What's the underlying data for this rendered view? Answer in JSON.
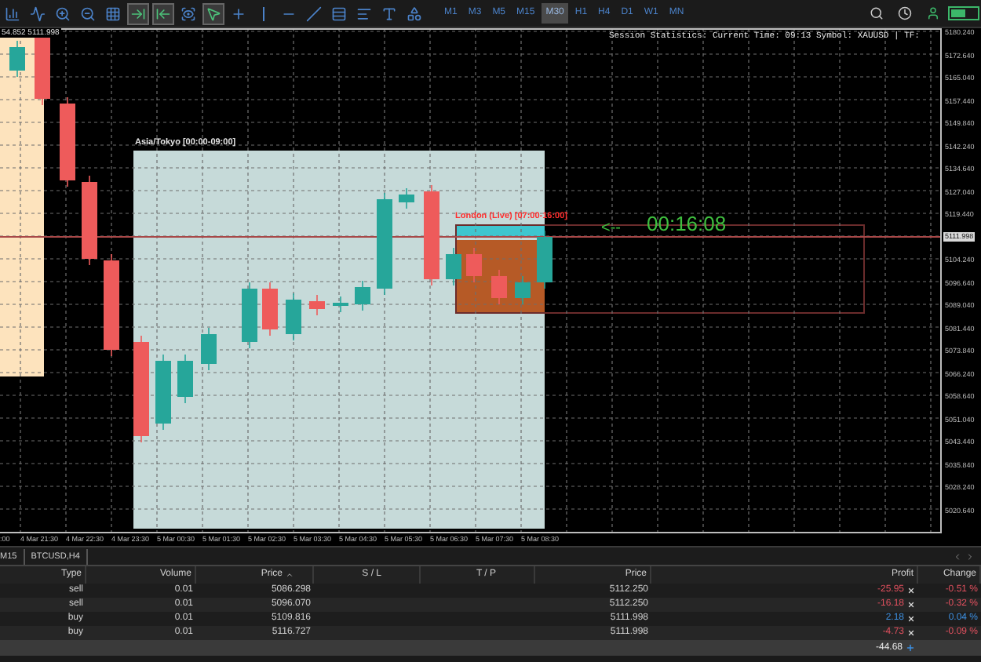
{
  "toolbar": {
    "tools": [
      {
        "kind": "indicator",
        "selected": false
      },
      {
        "kind": "chart-line",
        "selected": false
      },
      {
        "kind": "zoom-in",
        "selected": false
      },
      {
        "kind": "zoom-out",
        "selected": false
      },
      {
        "kind": "grid",
        "selected": false
      },
      {
        "kind": "autoscroll",
        "selected": true
      },
      {
        "kind": "shift",
        "selected": true
      },
      {
        "kind": "camera",
        "selected": false
      },
      {
        "kind": "cursor",
        "selected": true
      },
      {
        "kind": "crosshair",
        "selected": false
      },
      {
        "kind": "vline",
        "selected": false
      },
      {
        "kind": "hline",
        "selected": false
      },
      {
        "kind": "trend",
        "selected": false
      },
      {
        "kind": "channel",
        "selected": false
      },
      {
        "kind": "fibo",
        "selected": false
      },
      {
        "kind": "text",
        "selected": false
      },
      {
        "kind": "shapes",
        "selected": false
      }
    ],
    "timeframes": [
      {
        "label": "M1",
        "selected": false
      },
      {
        "label": "M3",
        "selected": false
      },
      {
        "label": "M5",
        "selected": false
      },
      {
        "label": "M15",
        "selected": false
      },
      {
        "label": "M30",
        "selected": true
      },
      {
        "label": "H1",
        "selected": false
      },
      {
        "label": "H4",
        "selected": false
      },
      {
        "label": "D1",
        "selected": false
      },
      {
        "label": "W1",
        "selected": false
      },
      {
        "label": "MN",
        "selected": false
      }
    ]
  },
  "chart": {
    "ohlc_header": "54.852 5111.998",
    "session_statistics": "Session Statistics: Current Time: 09:13 Symbol: XAUUSD | TF:",
    "asia_label": "Asia/Tokyo [00:00-09:00]",
    "london_label": "London (Live) [07:00-16:00]",
    "countdown_arrow": "<--",
    "countdown": "00:16:08",
    "current_price": "5111.998",
    "price_axis_upper": [
      "5180.240",
      "5172.640",
      "5165.040",
      "5157.440",
      "5149.840",
      "5142.240",
      "5134.640",
      "5127.040",
      "5119.440"
    ],
    "price_axis_lower": [
      "5104.240",
      "5096.640",
      "5089.040",
      "5081.440",
      "5073.840",
      "5066.240",
      "5058.640",
      "5051.040",
      "5043.440",
      "5035.840",
      "5028.240",
      "5020.640"
    ],
    "time_axis": [
      ":00",
      "4 Mar 21:30",
      "4 Mar 22:30",
      "4 Mar 23:30",
      "5 Mar 00:30",
      "5 Mar 01:30",
      "5 Mar 02:30",
      "5 Mar 03:30",
      "5 Mar 04:30",
      "5 Mar 05:30",
      "5 Mar 06:30",
      "5 Mar 07:30",
      "5 Mar 08:30"
    ]
  },
  "chart_tabs": [
    {
      "label": "M15"
    },
    {
      "label": "BTCUSD,H4"
    }
  ],
  "table": {
    "columns": [
      "Type",
      "Volume",
      "Price",
      "S / L",
      "T / P",
      "Price",
      "Profit",
      "Change"
    ],
    "rows": [
      {
        "type": "sell",
        "volume": "0.01",
        "price": "5086.298",
        "price_2": "5112.250",
        "profit": "-25.95",
        "change": "-0.51 %",
        "color": "#e0505e"
      },
      {
        "type": "sell",
        "volume": "0.01",
        "price": "5096.070",
        "price_2": "5112.250",
        "profit": "-16.18",
        "change": "-0.32 %",
        "color": "#e0505e"
      },
      {
        "type": "buy",
        "volume": "0.01",
        "price": "5109.816",
        "price_2": "5111.998",
        "profit": "2.18",
        "change": "0.04 %",
        "color": "#3d8fe0"
      },
      {
        "type": "buy",
        "volume": "0.01",
        "price": "5116.727",
        "price_2": "5111.998",
        "profit": "-4.73",
        "change": "-0.09 %",
        "color": "#e0505e"
      }
    ],
    "total": "-44.68"
  }
}
